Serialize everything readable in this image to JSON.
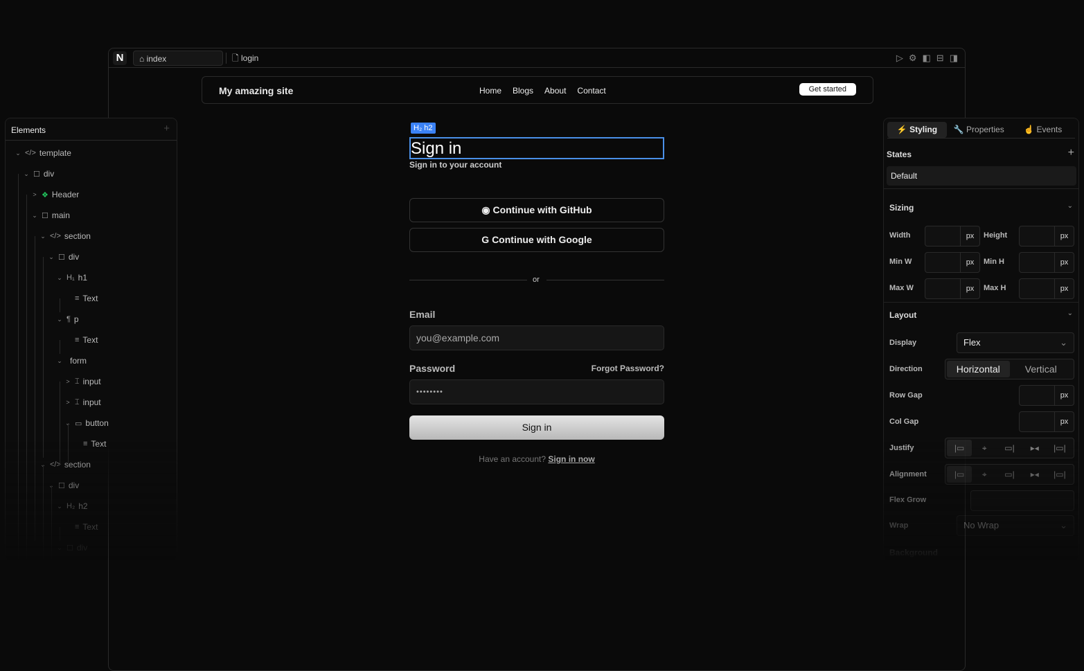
{
  "app": {
    "logo": "N",
    "tabs": [
      {
        "label": "index",
        "icon": "home-icon",
        "active": true
      },
      {
        "label": "login",
        "icon": "file-icon",
        "active": false
      }
    ],
    "toolbar_icons": [
      "play-icon",
      "gear-icon",
      "left-panel-icon",
      "bottom-panel-icon",
      "right-panel-icon"
    ]
  },
  "site": {
    "title": "My amazing site",
    "nav": [
      "Home",
      "Blogs",
      "About",
      "Contact"
    ],
    "cta": "Get started"
  },
  "selection": {
    "badge": "H₂ h2",
    "color": "#3b82f6"
  },
  "login": {
    "heading": "Sign in",
    "subheading": "Sign in to your account",
    "github": "Continue with GitHub",
    "google": "Continue with Google",
    "divider": "or",
    "email_label": "Email",
    "email_placeholder": "you@example.com",
    "password_label": "Password",
    "forgot": "Forgot Password?",
    "password_value": "••••••••",
    "submit": "Sign in",
    "footer_text": "Have an account?",
    "footer_link": "Sign in now"
  },
  "elements": {
    "title": "Elements",
    "tree": [
      {
        "label": "template",
        "icon": "</>",
        "level": 0,
        "chev": "v"
      },
      {
        "label": "div",
        "icon": "☐",
        "level": 1,
        "chev": "v"
      },
      {
        "label": "Header",
        "icon": "❖",
        "level": 2,
        "chev": ">"
      },
      {
        "label": "main",
        "icon": "☐",
        "level": 2,
        "chev": "v"
      },
      {
        "label": "section",
        "icon": "</>",
        "level": 3,
        "chev": "v"
      },
      {
        "label": "div",
        "icon": "☐",
        "level": 4,
        "chev": "v"
      },
      {
        "label": "h1",
        "icon": "H₁",
        "level": 5,
        "chev": "v"
      },
      {
        "label": "Text",
        "icon": "≡",
        "level": 6,
        "chev": ""
      },
      {
        "label": "p",
        "icon": "¶",
        "level": 5,
        "chev": "v"
      },
      {
        "label": "Text",
        "icon": "≡",
        "level": 6,
        "chev": ""
      },
      {
        "label": "form",
        "icon": "",
        "level": 5,
        "chev": "v"
      },
      {
        "label": "input",
        "icon": "⌶",
        "level": 6,
        "chev": ">"
      },
      {
        "label": "input",
        "icon": "⌶",
        "level": 6,
        "chev": ">"
      },
      {
        "label": "button",
        "icon": "▭",
        "level": 6,
        "chev": "v"
      },
      {
        "label": "Text",
        "icon": "≡",
        "level": 7,
        "chev": ""
      },
      {
        "label": "section",
        "icon": "</>",
        "level": 3,
        "chev": "v"
      },
      {
        "label": "div",
        "icon": "☐",
        "level": 4,
        "chev": "v"
      },
      {
        "label": "h2",
        "icon": "H₂",
        "level": 5,
        "chev": "v"
      },
      {
        "label": "Text",
        "icon": "≡",
        "level": 6,
        "chev": ""
      },
      {
        "label": "div",
        "icon": "☐",
        "level": 5,
        "chev": "v"
      }
    ]
  },
  "inspector": {
    "tabs": [
      "Styling",
      "Properties",
      "Events"
    ],
    "states_label": "States",
    "state": "Default",
    "sizing": {
      "title": "Sizing",
      "width": "Width",
      "height": "Height",
      "min_w": "Min W",
      "min_h": "Min H",
      "max_w": "Max W",
      "max_h": "Max H",
      "unit": "px"
    },
    "layout": {
      "title": "Layout",
      "display_label": "Display",
      "display": "Flex",
      "direction_label": "Direction",
      "directions": [
        "Horizontal",
        "Vertical"
      ],
      "row_gap": "Row Gap",
      "col_gap": "Col Gap",
      "justify": "Justify",
      "alignment": "Alignment",
      "flex_grow": "Flex Grow",
      "wrap_label": "Wrap",
      "wrap": "No Wrap"
    },
    "background": "Background"
  }
}
